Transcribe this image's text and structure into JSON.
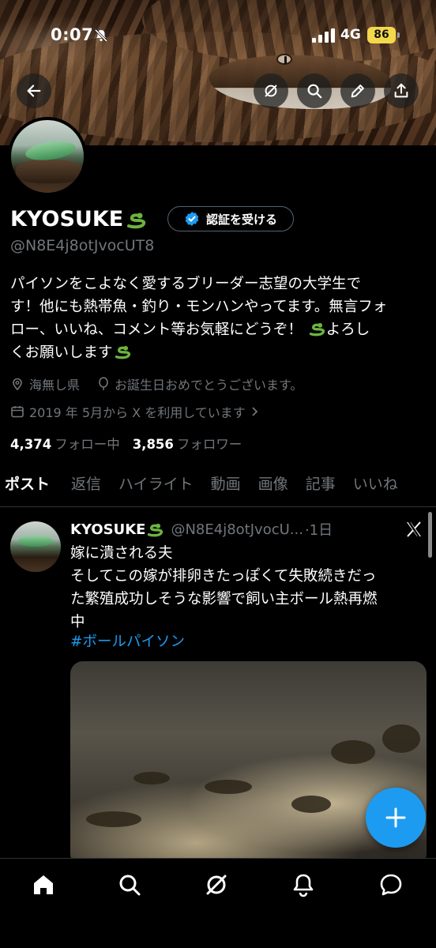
{
  "status_bar": {
    "time": "0:07",
    "network": "4G",
    "battery": "86"
  },
  "profile": {
    "display_name": "KYOSUKE",
    "handle": "@N8E4j8otJvocUT8",
    "verify_label": "認証を受ける",
    "bio_lines": [
      "パイソンをこよなく愛するブリーダー志望の大学生で",
      "す！他にも熱帯魚・釣り・モンハンやってます。無言フォ",
      "ロー、いいね、コメント等お気軽にどうぞ！",
      "よろし",
      "くお願いします"
    ],
    "location": "海無し県",
    "birthday": "お誕生日おめでとうございます。",
    "joined": "2019 年 5月から X を利用しています",
    "following_count": "4,374",
    "following_label": "フォロー中",
    "followers_count": "3,856",
    "followers_label": "フォロワー"
  },
  "tabs": [
    "ポスト",
    "返信",
    "ハイライト",
    "動画",
    "画像",
    "記事",
    "いいね"
  ],
  "tweet": {
    "name": "KYOSUKE",
    "handle": "@N8E4j8otJvocU...",
    "time": "·1日",
    "lines": [
      "嫁に潰される夫",
      "そしてこの嫁が排卵きたっぽくて失敗続きだっ",
      "た繁殖成功しそうな影響で飼い主ボール熱再燃",
      "中"
    ],
    "hashtag": "#ボールパイソン"
  },
  "icons": {
    "back": "arrow-left-icon",
    "grok": "grok-icon",
    "search": "search-icon",
    "edit": "pencil-icon",
    "share": "share-icon",
    "fab": "plus-icon"
  },
  "colors": {
    "accent": "#1d9bf0",
    "battery": "#f4d84c",
    "muted": "#71767b"
  }
}
